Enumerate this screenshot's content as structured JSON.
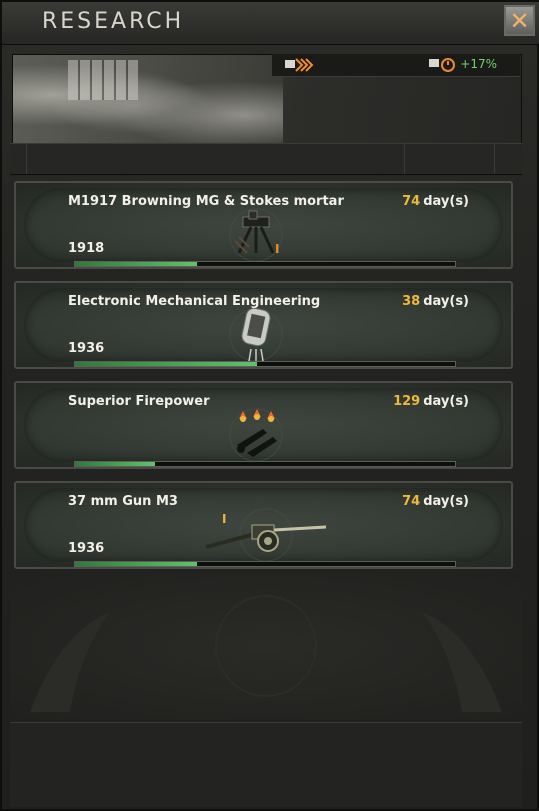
{
  "window": {
    "title": "Research"
  },
  "bonus": {
    "value": "+17%"
  },
  "colors": {
    "accent_days": "#f0b83a",
    "bonus_green": "#6fd36a",
    "progress_green": "#63c16c"
  },
  "slots": [
    {
      "name": "M1917 Browning MG & Stokes mortar",
      "days": "74",
      "days_unit": "day(s)",
      "year": "1918",
      "progress": 0.32,
      "icon": "machine-gun-icon"
    },
    {
      "name": "Electronic Mechanical Engineering",
      "days": "38",
      "days_unit": "day(s)",
      "year": "1936",
      "progress": 0.48,
      "icon": "vacuum-tube-icon"
    },
    {
      "name": "Superior Firepower",
      "days": "129",
      "days_unit": "day(s)",
      "year": "",
      "progress": 0.21,
      "icon": "firepower-icon"
    },
    {
      "name": "37 mm Gun M3",
      "days": "74",
      "days_unit": "day(s)",
      "year": "1936",
      "progress": 0.32,
      "icon": "anti-tank-gun-icon"
    }
  ]
}
